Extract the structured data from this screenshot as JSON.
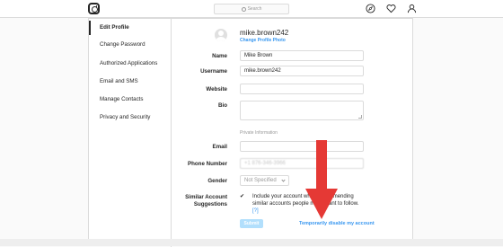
{
  "topbar": {
    "search_placeholder": "Search",
    "icons": [
      "instagram-logo",
      "compass-icon",
      "heart-icon",
      "profile-icon"
    ]
  },
  "sidebar": {
    "items": [
      {
        "label": "Edit Profile",
        "active": true
      },
      {
        "label": "Change Password",
        "active": false
      },
      {
        "label": "Authorized Applications",
        "active": false
      },
      {
        "label": "Email and SMS",
        "active": false
      },
      {
        "label": "Manage Contacts",
        "active": false
      },
      {
        "label": "Privacy and Security",
        "active": false
      }
    ]
  },
  "profile": {
    "username": "mike.brown242",
    "change_photo_label": "Change Profile Photo"
  },
  "form": {
    "name_label": "Name",
    "name_value": "Mike Brown",
    "username_label": "Username",
    "username_value": "mike.brown242",
    "website_label": "Website",
    "website_value": "",
    "bio_label": "Bio",
    "bio_value": "",
    "private_section_title": "Private Information",
    "email_label": "Email",
    "email_value": "",
    "phone_label": "Phone Number",
    "phone_value": "+1 876-346-3966",
    "gender_label": "Gender",
    "gender_value": "Not Specified",
    "suggestions_label_line1": "Similar Account",
    "suggestions_label_line2": "Suggestions",
    "suggestions_checked": true,
    "suggestions_text": "Include your account when recommending similar accounts people might want to follow.",
    "suggestions_help": "[?]",
    "submit_label": "Submit",
    "disable_label": "Temporarily disable my account"
  },
  "colors": {
    "accent": "#3897f0",
    "arrow": "#e53935",
    "submit_disabled": "#b2dffc"
  }
}
